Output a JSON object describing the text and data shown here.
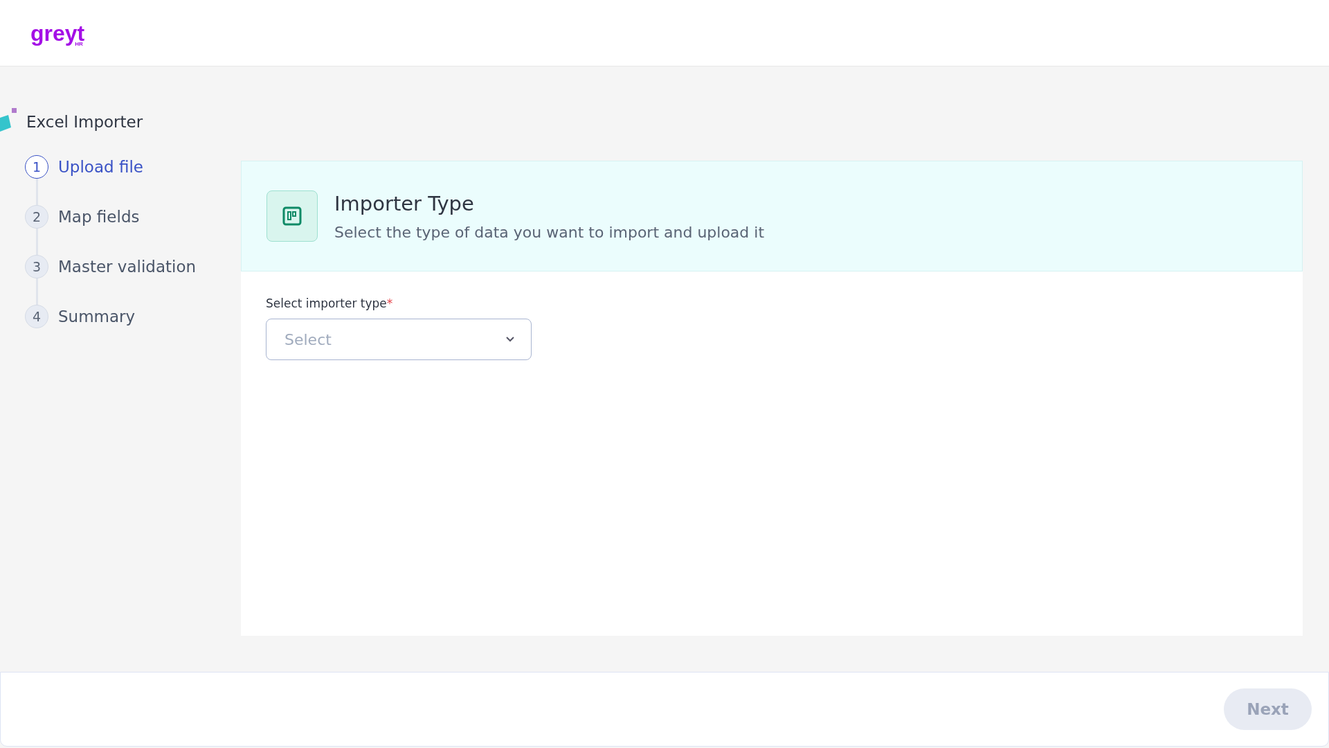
{
  "logo": {
    "text": "greyt",
    "subtext": "HR"
  },
  "sidebar": {
    "title": "Excel Importer",
    "steps": [
      {
        "number": "1",
        "label": "Upload file",
        "selected": true
      },
      {
        "number": "2",
        "label": "Map fields",
        "selected": false
      },
      {
        "number": "3",
        "label": "Master validation",
        "selected": false
      },
      {
        "number": "4",
        "label": "Summary",
        "selected": false
      }
    ]
  },
  "panel": {
    "title": "Importer Type",
    "subtitle": "Select the type of data you want to import and upload it",
    "field": {
      "label": "Select importer type",
      "required_mark": "*",
      "placeholder": "Select"
    }
  },
  "footer": {
    "next_button": {
      "label": "Next",
      "disabled": true
    }
  }
}
